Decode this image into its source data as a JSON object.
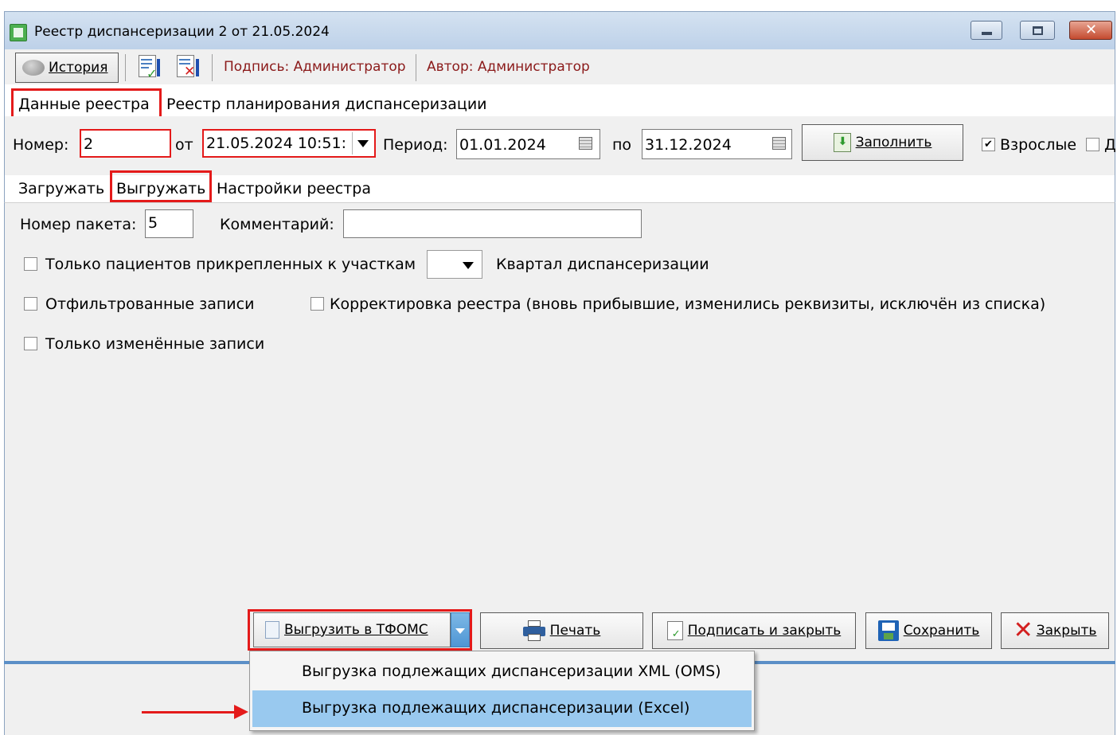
{
  "window": {
    "title": "Реестр диспансеризации 2 от 21.05.2024",
    "controls": [
      "minimize",
      "maximize",
      "close"
    ]
  },
  "toolbar": {
    "history_label": "История",
    "sign_label": "Подпись: Администратор",
    "author_label": "Автор: Администратор"
  },
  "main_tabs": [
    "Данные реестра",
    "Реестр планирования диспансеризации"
  ],
  "header_row": {
    "number_label": "Номер:",
    "number_value": "2",
    "from_label": "от",
    "date_value": "21.05.2024 10:51:",
    "period_label": "Период:",
    "period_from": "01.01.2024",
    "to_label": "по",
    "period_to": "31.12.2024",
    "fill_label": "Заполнить",
    "adults_label": "Взрослые",
    "adults_checked": true,
    "children_label": "Д"
  },
  "sub_tabs": [
    "Загружать",
    "Выгружать",
    "Настройки реестра"
  ],
  "upload_panel": {
    "packet_label": "Номер пакета:",
    "packet_value": "5",
    "comment_label": "Комментарий:",
    "comment_value": "",
    "only_attached_label": "Только пациентов прикрепленных к участкам",
    "quarter_label": "Квартал диспансеризации",
    "filtered_label": "Отфильтрованные записи",
    "correction_label": "Корректировка реестра (вновь прибывшие, изменились реквизиты, исключён из списка)",
    "only_changed_label": "Только изменённые записи"
  },
  "bottom_buttons": {
    "export_label": "Выгрузить в ТФОМС",
    "print_label": "Печать",
    "sign_close_label": "Подписать и закрыть",
    "save_label": "Сохранить",
    "close_label": "Закрыть"
  },
  "dropdown_menu": [
    "Выгрузка подлежащих диспансеризации XML (OMS)",
    "Выгрузка подлежащих диспансеризации (Excel)"
  ],
  "colors": {
    "accent_red": "#e41a1a",
    "menu_highlight": "#99c9ef",
    "title_bar": "#c5d7ec",
    "toolbar_text": "#8b1a1a"
  }
}
